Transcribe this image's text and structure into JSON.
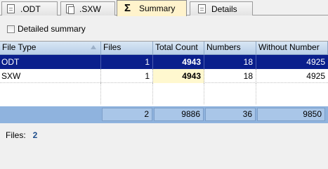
{
  "tabs": [
    {
      "label": ".ODT",
      "icon": "document-icon",
      "active": false
    },
    {
      "label": ".SXW",
      "icon": "document-icon",
      "active": false
    },
    {
      "label": "Summary",
      "icon": "sigma-icon",
      "active": true
    },
    {
      "label": "Details",
      "icon": "document-icon",
      "active": false
    }
  ],
  "checkbox": {
    "label": "Detailed summary",
    "checked": false
  },
  "table": {
    "columns": [
      "File Type",
      "Files",
      "Total Count",
      "Numbers",
      "Without Number"
    ],
    "rows": [
      {
        "type": "ODT",
        "files": "1",
        "total": "4943",
        "numbers": "18",
        "without": "4925",
        "selected": true
      },
      {
        "type": "SXW",
        "files": "1",
        "total": "4943",
        "numbers": "18",
        "without": "4925",
        "selected": false
      }
    ],
    "totals": {
      "files": "2",
      "total": "9886",
      "numbers": "36",
      "without": "9850"
    }
  },
  "status": {
    "label": "Files:",
    "value": "2"
  },
  "colors": {
    "selected_row": "#0a1f8c",
    "active_tab": "#fff3cc",
    "totals_bg": "#8fb3de"
  }
}
